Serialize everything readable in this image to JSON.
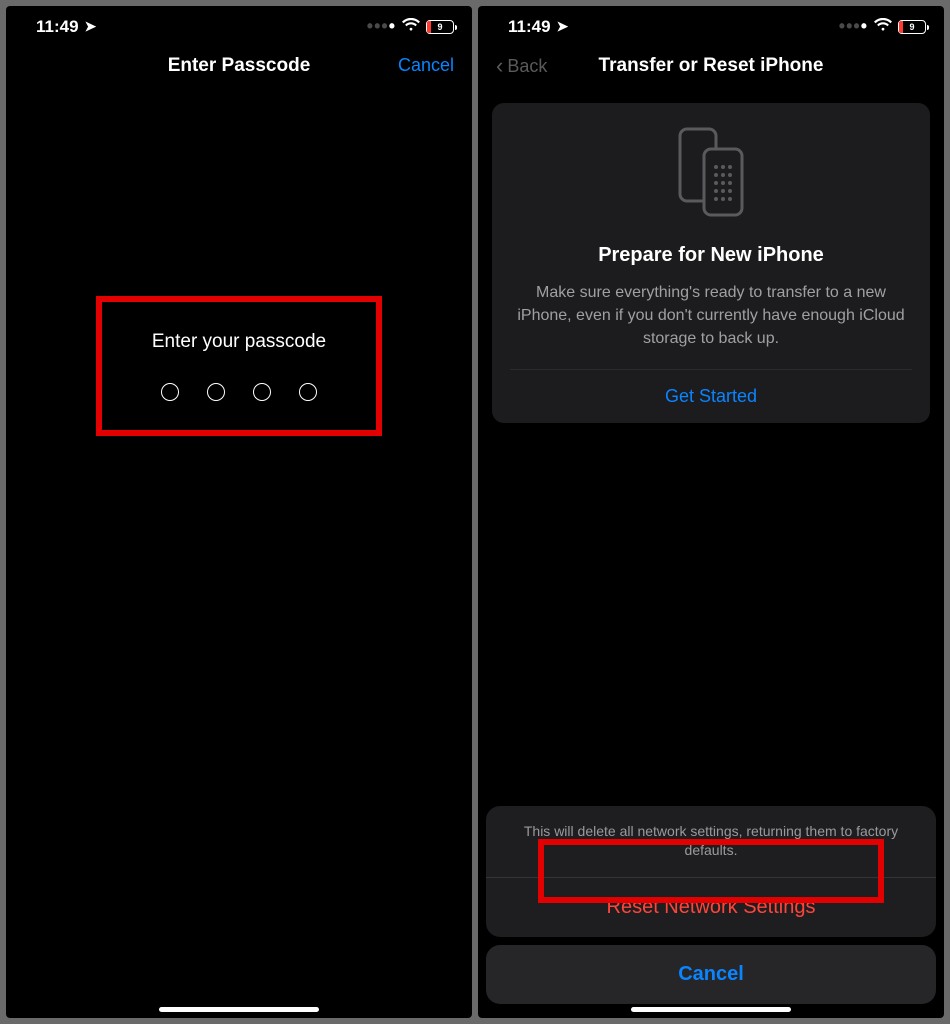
{
  "statusbar": {
    "time": "11:49",
    "battery_text": "9"
  },
  "left": {
    "nav": {
      "title": "Enter Passcode",
      "cancel": "Cancel"
    },
    "passcode_prompt": "Enter your passcode"
  },
  "right": {
    "nav": {
      "back": "Back",
      "title": "Transfer or Reset iPhone"
    },
    "card": {
      "title": "Prepare for New iPhone",
      "desc": "Make sure everything's ready to transfer to a new iPhone, even if you don't currently have enough iCloud storage to back up.",
      "button": "Get Started"
    },
    "sheet": {
      "message": "This will delete all network settings, returning them to factory defaults.",
      "reset": "Reset Network Settings",
      "cancel": "Cancel"
    }
  }
}
